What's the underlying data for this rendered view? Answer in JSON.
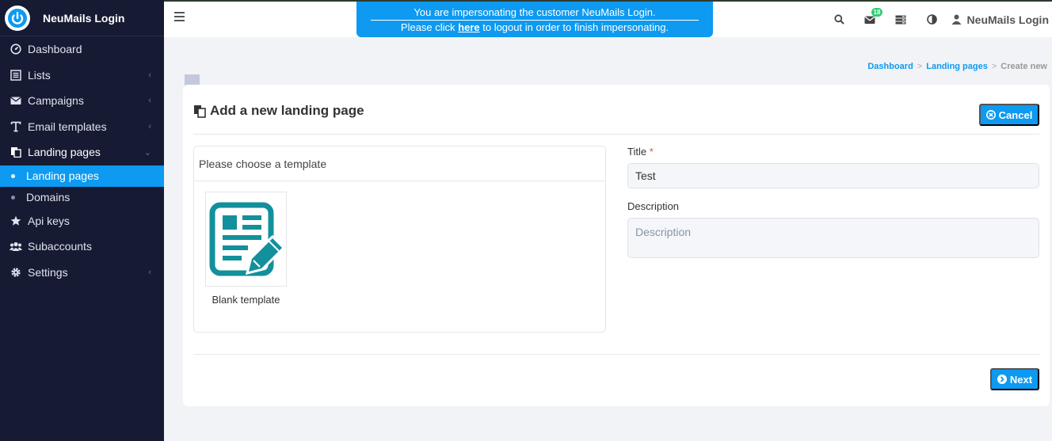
{
  "brand": {
    "title": "NeuMails Login"
  },
  "sidebar": {
    "items": [
      {
        "label": "Dashboard",
        "icon": "dashboard-icon"
      },
      {
        "label": "Lists",
        "icon": "list-icon"
      },
      {
        "label": "Campaigns",
        "icon": "envelope-icon"
      },
      {
        "label": "Email templates",
        "icon": "text-icon"
      },
      {
        "label": "Landing pages",
        "icon": "copy-icon"
      }
    ],
    "sub_items": [
      {
        "label": "Landing pages"
      },
      {
        "label": "Domains"
      }
    ],
    "items_after": [
      {
        "label": "Api keys",
        "icon": "star-icon"
      },
      {
        "label": "Subaccounts",
        "icon": "users-icon"
      },
      {
        "label": "Settings",
        "icon": "gear-icon"
      }
    ]
  },
  "banner": {
    "line1": "You are impersonating the customer NeuMails Login.",
    "line2_prefix": "Please click ",
    "line2_link": "here",
    "line2_suffix": " to logout in order to finish impersonating."
  },
  "topbar": {
    "notification_count": "18",
    "user_name": "NeuMails Login"
  },
  "breadcrumb": {
    "items": [
      "Dashboard",
      "Landing pages"
    ],
    "current": "Create new",
    "separator": ">"
  },
  "page": {
    "title": "Add a new landing page",
    "cancel_label": "Cancel",
    "next_label": "Next"
  },
  "templates": {
    "heading": "Please choose a template",
    "items": [
      {
        "name": "Blank template"
      }
    ]
  },
  "form": {
    "title_label": "Title",
    "title_required_mark": "*",
    "title_value": "Test",
    "description_label": "Description",
    "description_placeholder": "Description"
  },
  "colors": {
    "accent": "#0d9af0",
    "sidebar_bg": "#161b33",
    "badge": "#2ecc71",
    "template_icon": "#12909b"
  }
}
